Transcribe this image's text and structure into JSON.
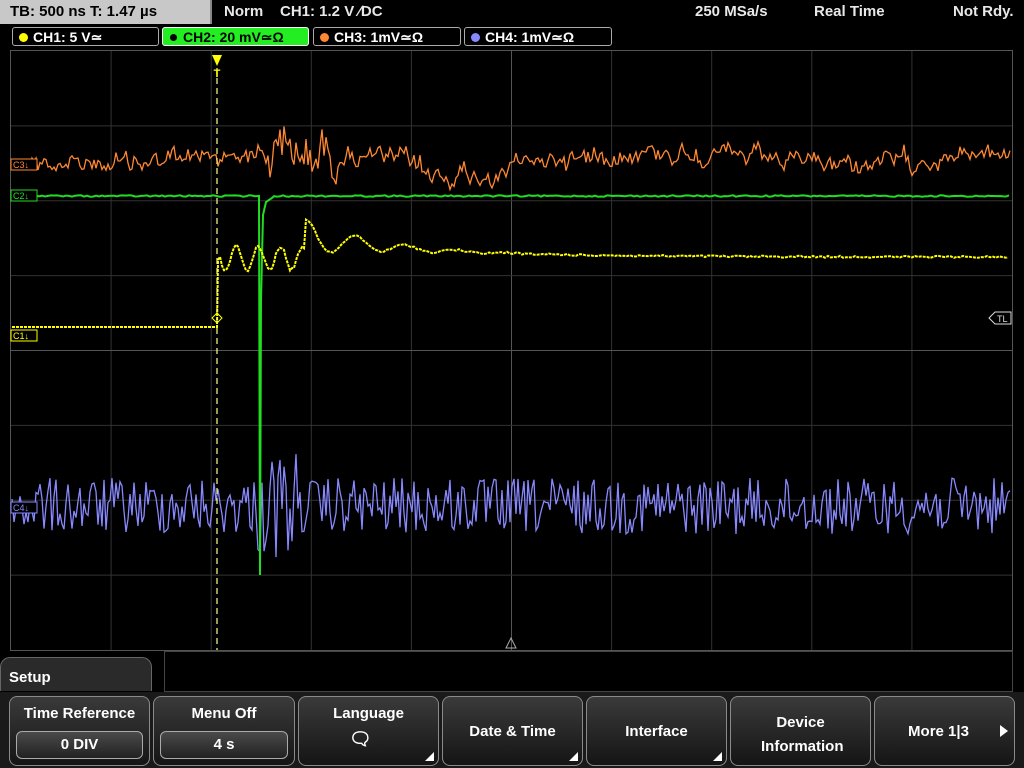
{
  "status": {
    "timebase": "TB: 500 ns   T: 1.47 µs",
    "trigger_mode": "Norm",
    "trigger_source": "CH1: 1.2 V ∕DC",
    "sample_rate": "250 MSa/s",
    "acq_mode": "Real Time",
    "ready": "Not Rdy."
  },
  "channels": [
    {
      "label": "CH1: 5 V≃",
      "color": "#ffff00",
      "active": false
    },
    {
      "label": "CH2: 20 mV≃Ω",
      "color": "#22dd22",
      "active": true
    },
    {
      "label": "CH3: 1mV≃Ω",
      "color": "#ff8833",
      "active": false
    },
    {
      "label": "CH4: 1mV≃Ω",
      "color": "#8888ff",
      "active": false
    }
  ],
  "markers": {
    "c3": "C3↓",
    "c2": "C2↓",
    "c1": "C1↓",
    "c4": "C4↓",
    "trigger_level": "TL",
    "trigger_pos": "T"
  },
  "menu": {
    "title": "Setup",
    "keys": [
      {
        "label": "Time Reference",
        "value": "0 DIV"
      },
      {
        "label": "Menu Off",
        "value": "4 s"
      },
      {
        "label": "Language",
        "value": ""
      },
      {
        "label": "Date & Time"
      },
      {
        "label": "Interface"
      },
      {
        "label": "Device Information"
      },
      {
        "label": "More 1|3"
      }
    ]
  },
  "colors": {
    "ch1": "#ffff00",
    "ch2": "#22dd22",
    "ch3": "#ff8833",
    "ch4": "#8888ff",
    "grid": "#3a3a3a"
  }
}
